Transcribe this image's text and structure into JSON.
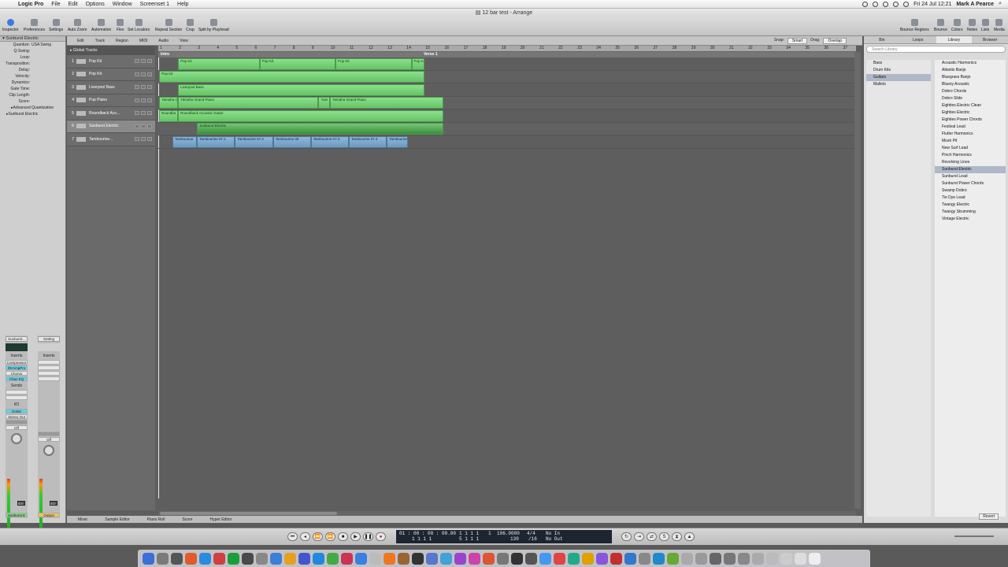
{
  "menubar": {
    "app": "Logic Pro",
    "items": [
      "File",
      "Edit",
      "Options",
      "Window",
      "Screenset 1",
      "Help"
    ],
    "clock": "Fri 24 Jul  12:21",
    "user": "Mark A Pearce"
  },
  "window": {
    "title": "12 bar test - Arrange"
  },
  "toolbar": {
    "left": [
      "Inspector",
      "Preferences",
      "Settings",
      "Auto Zoom",
      "Automation",
      "Flex",
      "Set Locators",
      "Repeat Section",
      "Crop",
      "Split by Playhead"
    ],
    "right": [
      "Bounce Regions",
      "Bounce",
      "Colors",
      "Notes",
      "Lists",
      "Media"
    ]
  },
  "inspector": {
    "region_name": "Sunburst Electric",
    "params": [
      {
        "k": "Quantize:",
        "v": "USA Swing"
      },
      {
        "k": "Q-Swing:",
        "v": ""
      },
      {
        "k": "Loop:",
        "v": ""
      },
      {
        "k": "Transposition:",
        "v": ""
      },
      {
        "k": "Delay:",
        "v": ""
      },
      {
        "k": "Velocity:",
        "v": ""
      },
      {
        "k": "Dynamics:",
        "v": ""
      },
      {
        "k": "Gate Time:",
        "v": ""
      },
      {
        "k": "Clip Length:",
        "v": ""
      },
      {
        "k": "Score:",
        "v": ""
      }
    ],
    "advanced": "Advanced Quantization",
    "track_name": "Sunburst Electric",
    "strip1": {
      "name": "Sunburst...",
      "inserts_label": "Inserts",
      "inserts": [
        "Compressor",
        "GtrAmpPro",
        "Chorus",
        "Chan EQ"
      ],
      "sends": "Sends",
      "io": "I/O",
      "input": "Guitar",
      "output": "Stereo Out",
      "off": "Off",
      "value": "0.0",
      "footer": "Sunburst E"
    },
    "strip2": {
      "name": "Setting",
      "inserts_label": "Inserts",
      "off": "Off",
      "value": "0.0",
      "footer": "Output"
    }
  },
  "arrange": {
    "edit_menus": [
      "Edit",
      "Track",
      "Region",
      "MIDI",
      "Audio",
      "View"
    ],
    "snap_label": "Snap:",
    "snap": "Smart",
    "drag_label": "Drag:",
    "drag": "Overlap",
    "global_tracks": "Global Tracks",
    "ruler": [
      "1",
      "2",
      "3",
      "4",
      "5",
      "6",
      "7",
      "8",
      "9",
      "10",
      "11",
      "12",
      "13",
      "14",
      "15",
      "16",
      "17",
      "18",
      "19",
      "20",
      "21",
      "22",
      "23",
      "24",
      "25",
      "26",
      "27",
      "28",
      "29",
      "30",
      "31",
      "32",
      "33",
      "34",
      "35",
      "36",
      "37"
    ],
    "markers": [
      "Intro",
      "Verse 1"
    ],
    "tracks": [
      {
        "num": "1",
        "name": "Pop Kit"
      },
      {
        "num": "2",
        "name": "Pop Kit"
      },
      {
        "num": "3",
        "name": "Liverpool Bass"
      },
      {
        "num": "4",
        "name": "Pop Piano"
      },
      {
        "num": "5",
        "name": "Roundback Aco..."
      },
      {
        "num": "6",
        "name": "Sunburst Electric"
      },
      {
        "num": "7",
        "name": "Tambourine..."
      }
    ],
    "regions": [
      {
        "t": 0,
        "name": "Pop Kit",
        "s": 2,
        "e": 6.3,
        "c": "g"
      },
      {
        "t": 0,
        "name": "Pop Kit",
        "s": 6.3,
        "e": 10.3,
        "c": "g"
      },
      {
        "t": 0,
        "name": "Pop Kit",
        "s": 10.3,
        "e": 14.3,
        "c": "g"
      },
      {
        "t": 0,
        "name": "Pop Kit",
        "s": 14.3,
        "e": 15,
        "c": "g"
      },
      {
        "t": 1,
        "name": "Pop Kit",
        "s": 1,
        "e": 15,
        "c": "g"
      },
      {
        "t": 2,
        "name": "Liverpool Bass",
        "s": 2,
        "e": 15,
        "c": "g"
      },
      {
        "t": 3,
        "name": "Yamaha C",
        "s": 1,
        "e": 2,
        "c": "g"
      },
      {
        "t": 3,
        "name": "Yamaha Grand Piano",
        "s": 2,
        "e": 9.4,
        "c": "g"
      },
      {
        "t": 3,
        "name": "Yam",
        "s": 9.4,
        "e": 10,
        "c": "g"
      },
      {
        "t": 3,
        "name": "Yamaha Grand Piano",
        "s": 10,
        "e": 16,
        "c": "g"
      },
      {
        "t": 4,
        "name": "Roundba",
        "s": 1,
        "e": 2,
        "c": "g"
      },
      {
        "t": 4,
        "name": "Roundback Acoustic Guitar",
        "s": 2,
        "e": 16,
        "c": "g"
      },
      {
        "t": 5,
        "name": "Sunburst Electric",
        "s": 3,
        "e": 16,
        "c": "d"
      },
      {
        "t": 6,
        "name": "Tambourine",
        "s": 1.7,
        "e": 3,
        "c": "b"
      },
      {
        "t": 6,
        "name": "Tambourine 07.1",
        "s": 3,
        "e": 5,
        "c": "b"
      },
      {
        "t": 6,
        "name": "Tambourine 07.2",
        "s": 5,
        "e": 7,
        "c": "b"
      },
      {
        "t": 6,
        "name": "Tambourine 08",
        "s": 7,
        "e": 9,
        "c": "b"
      },
      {
        "t": 6,
        "name": "Tambourine 07.3",
        "s": 9,
        "e": 11,
        "c": "b"
      },
      {
        "t": 6,
        "name": "Tambourine 07.4",
        "s": 11,
        "e": 13,
        "c": "b"
      },
      {
        "t": 6,
        "name": "Tambourine",
        "s": 13,
        "e": 14.1,
        "c": "b"
      }
    ],
    "bottom_tabs": [
      "Mixer",
      "Sample Editor",
      "Piano Roll",
      "Score",
      "Hyper Editor"
    ]
  },
  "library": {
    "tabs": [
      "Bin",
      "Loops",
      "Library",
      "Browser"
    ],
    "search_placeholder": "Search Library",
    "categories": [
      "Bass",
      "Drum Kits",
      "Guitars",
      "Mallets"
    ],
    "selected_category": "Guitars",
    "patches": [
      "Acoustic Harmonics",
      "Atlantis Banjo",
      "Bluegrass Banjo",
      "Bluesy Acoustic",
      "Dobro Chords",
      "Dobro Slide",
      "Eighties Electric Clean",
      "Eighties Electric",
      "Eighties Power Chords",
      "Festival Lead",
      "Flutter Harmonics",
      "Mosh Pit",
      "New Surf Lead",
      "Pinch Harmonics",
      "Revolving Lines",
      "Sunburst Electric",
      "Sunburst Lead",
      "Sunburst Power Chords",
      "Swamp Dobro",
      "Tie Dye Lead",
      "Twangy Electric",
      "Twangy Strumming",
      "Vintage Electric"
    ],
    "selected_patch": "Sunburst Electric",
    "revert": "Revert"
  },
  "transport": {
    "smpte": "01 : 00 : 00 : 00.00",
    "bars_top": "1  1  1  1",
    "bars_bottom": "1  1  1  1",
    "pos_top": "1",
    "pos_bottom": "5  1  1  1",
    "tempo": "106.0000",
    "tempo2": "130",
    "sig": "4/4",
    "div": "/16",
    "in": "No In",
    "out": "No Out"
  },
  "colors": {
    "region_green": "#7fd67f",
    "region_blue": "#7ea9cf",
    "accent": "#5fd0e8"
  }
}
